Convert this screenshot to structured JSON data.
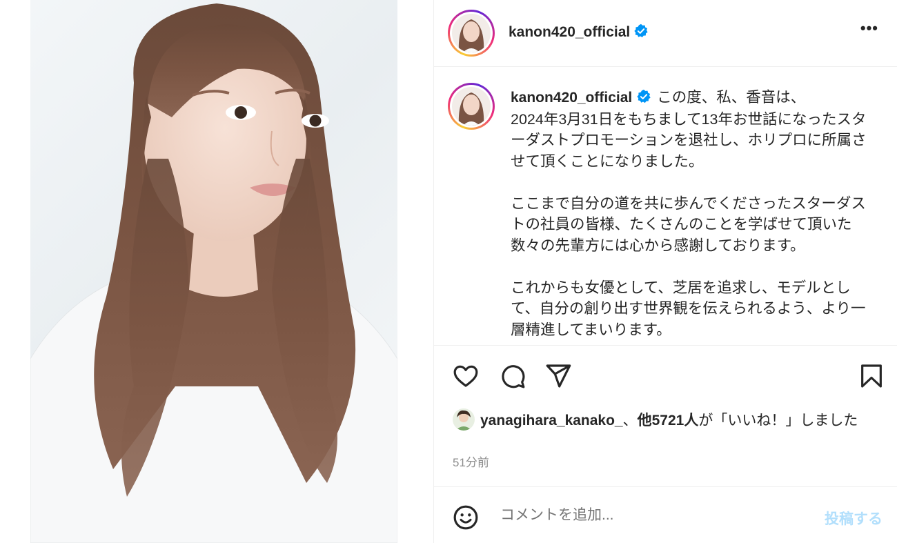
{
  "post": {
    "username": "kanon420_official",
    "verified_icon": "verified-badge-icon",
    "more_label": "•••",
    "caption_paragraphs": [
      "この度、私、香音は、\n2024年3月31日をもちまして13年お世話になったスターダストプロモーションを退社し、ホリプロに所属させて頂くことになりました。",
      "ここまで自分の道を共に歩んでくださったスターダストの社員の皆様、たくさんのことを学ばせて頂いた数々の先輩方には心から感謝しております。",
      "これからも女優として、芝居を追求し、モデルとして、自分の創り出す世界観を伝えられるよう、より一層精進してまいります。"
    ]
  },
  "likes": {
    "liker": "yanagihara_kanako_",
    "separator": "、",
    "others": "他5721人",
    "suffix": "が「いいね！」しました"
  },
  "timestamp": "51分前",
  "comment": {
    "placeholder": "コメントを追加...",
    "post_label": "投稿する"
  },
  "colors": {
    "accent": "#0095f6",
    "post_disabled": "#b2dffc",
    "verified": "#0095f6",
    "muted": "#8e8e8e"
  }
}
